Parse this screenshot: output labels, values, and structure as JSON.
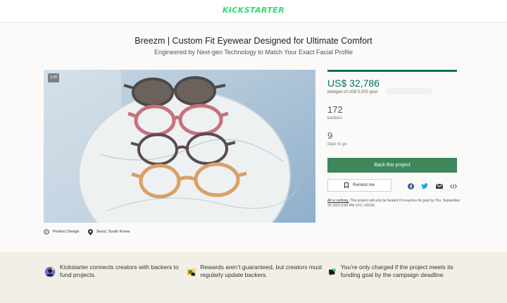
{
  "header": {
    "logo": "KICKSTARTER"
  },
  "project": {
    "title": "Breezm | Custom Fit Eyewear Designed for Ultimate Comfort",
    "subtitle": "Engineered by Next-gen Technology to Match Your Exact Facial Profile"
  },
  "video": {
    "timestamp": "1:00"
  },
  "meta": {
    "category": "Product Design",
    "location": "Seoul, South Korea"
  },
  "stats": {
    "pledged": "US$ 32,786",
    "pledged_goal": "pledged of US$ 5,000 goal",
    "progress_fraction": 1.0,
    "backers": "172",
    "backers_label": "backers",
    "days": "9",
    "days_label": "days to go"
  },
  "actions": {
    "back_label": "Back this project",
    "remind_label": "Remind me",
    "share_icons": [
      "facebook-icon",
      "twitter-icon",
      "email-icon",
      "embed-icon"
    ]
  },
  "disclaimer": {
    "link": "All or nothing.",
    "text": " This project will only be funded if it reaches its goal by Thu, September 29 2022 9:00 PM UTC +09:00."
  },
  "features": [
    {
      "icon": "creators-icon",
      "text": "Kickstarter connects creators with backers to fund projects."
    },
    {
      "icon": "updates-icon",
      "text": "Rewards aren’t guaranteed, but creators must regularly update backers."
    },
    {
      "icon": "funding-icon",
      "text": "You’re only charged if the project meets its funding goal by the campaign deadline."
    }
  ],
  "colors": {
    "brand": "#2bde73",
    "accent": "#037362",
    "button": "#3d875b",
    "band": "#f2efe7"
  }
}
